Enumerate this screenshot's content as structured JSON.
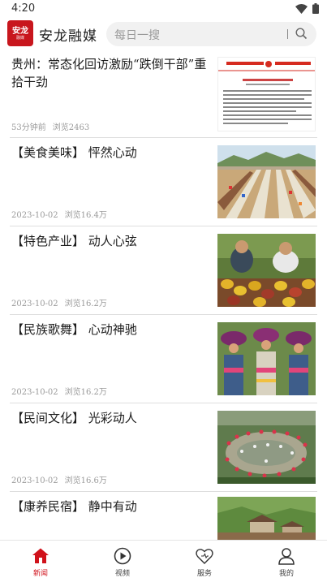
{
  "status_bar": {
    "time": "4:20"
  },
  "header": {
    "logo_text": "安龙",
    "logo_sub": "融媒",
    "app_name": "安龙融媒",
    "search_placeholder": "每日一搜"
  },
  "news": [
    {
      "title": "贵州：常态化回访激励“跌倒干部”重拾干劲",
      "date": "53分钟前",
      "views": "浏览2463",
      "image": "document-photo"
    },
    {
      "title": "【美食美味】 怦然心动",
      "date": "2023-10-02",
      "views": "浏览16.4万",
      "image": "long-table-feast-photo"
    },
    {
      "title": "【特色产业】 动人心弦",
      "date": "2023-10-02",
      "views": "浏览16.2万",
      "image": "fruit-harvest-photo"
    },
    {
      "title": "【民族歌舞】 心动神驰",
      "date": "2023-10-02",
      "views": "浏览16.2万",
      "image": "ethnic-dance-photo"
    },
    {
      "title": "【民间文化】 光彩动人",
      "date": "2023-10-02",
      "views": "浏览16.6万",
      "image": "folk-festival-photo"
    },
    {
      "title": "【康养民宿】 静中有动",
      "date": "",
      "views": "",
      "image": "guesthouse-photo"
    }
  ],
  "tabs": [
    {
      "label": "新闻",
      "icon": "home-icon",
      "active": true
    },
    {
      "label": "视频",
      "icon": "play-icon",
      "active": false
    },
    {
      "label": "服务",
      "icon": "heart-icon",
      "active": false
    },
    {
      "label": "我的",
      "icon": "user-icon",
      "active": false
    }
  ],
  "colors": {
    "accent": "#d0121b",
    "logo_bg": "#c8161d"
  }
}
